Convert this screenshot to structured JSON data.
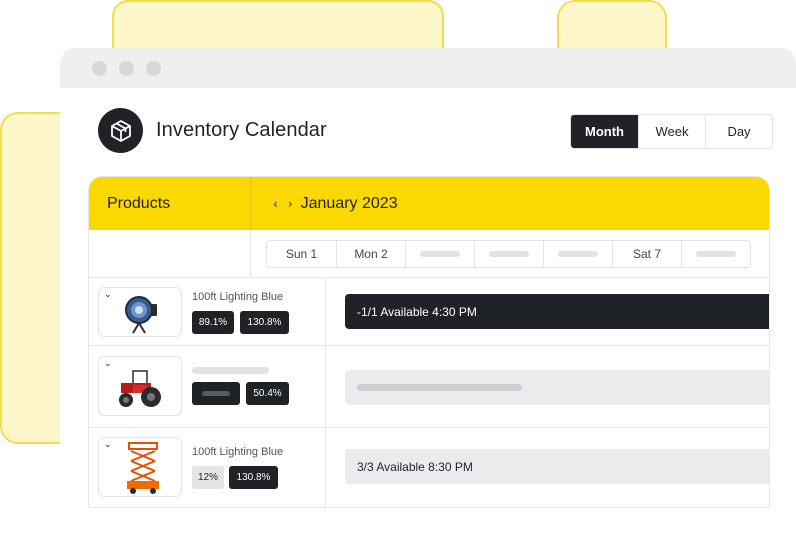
{
  "app": {
    "title": "Inventory Calendar",
    "logo_icon": "box-icon"
  },
  "view_toggle": {
    "options": [
      "Month",
      "Week",
      "Day"
    ],
    "selected": "Month"
  },
  "calendar": {
    "products_header": "Products",
    "month_label": "January 2023",
    "prev_icon": "chevron-left-icon",
    "next_icon": "chevron-right-icon",
    "days": [
      "Sun 1",
      "Mon 2",
      "",
      "",
      "",
      "Sat 7",
      ""
    ]
  },
  "rows": [
    {
      "name": "100ft Lighting Blue",
      "image_icon": "spotlight-icon",
      "badges": [
        "89.1%",
        "130.8%"
      ],
      "event": "-1/1 Available 4:30 PM"
    },
    {
      "name": "",
      "image_icon": "tractor-icon",
      "badges": [
        "",
        "50.4%"
      ],
      "event": ""
    },
    {
      "name": "100ft Lighting Blue",
      "image_icon": "scissor-lift-icon",
      "badges": [
        "12%",
        "130.8%"
      ],
      "event": "3/3 Available 8:30 PM"
    }
  ],
  "colors": {
    "accent_yellow": "#fbd800",
    "dark": "#1f2328",
    "decor_yellow": "#f7dc4a"
  }
}
